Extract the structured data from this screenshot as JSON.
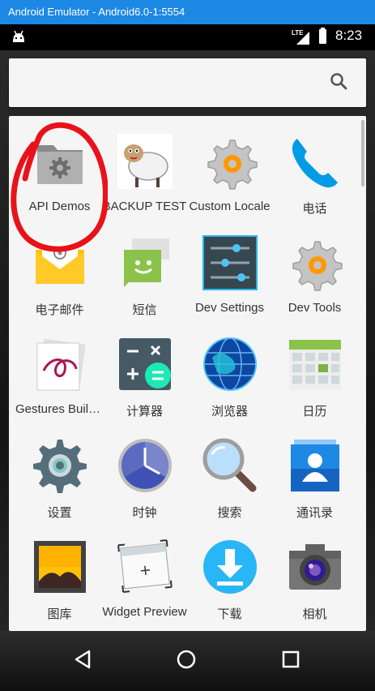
{
  "window": {
    "title": "Android Emulator - Android6.0-1:5554"
  },
  "status_bar": {
    "network": "LTE",
    "time": "8:23"
  },
  "search": {
    "placeholder": ""
  },
  "apps": [
    {
      "label": "API Demos",
      "icon": "settings-folder-icon"
    },
    {
      "label": "BACKUP TEST",
      "icon": "sheep-icon"
    },
    {
      "label": "Custom Locale",
      "icon": "gear-locale-icon"
    },
    {
      "label": "电话",
      "icon": "phone-icon"
    },
    {
      "label": "电子邮件",
      "icon": "email-icon"
    },
    {
      "label": "短信",
      "icon": "sms-icon"
    },
    {
      "label": "Dev Settings",
      "icon": "sliders-icon"
    },
    {
      "label": "Dev Tools",
      "icon": "gear-tools-icon"
    },
    {
      "label": "Gestures Builder",
      "icon": "gestures-icon"
    },
    {
      "label": "计算器",
      "icon": "calculator-icon"
    },
    {
      "label": "浏览器",
      "icon": "globe-icon"
    },
    {
      "label": "日历",
      "icon": "calendar-icon"
    },
    {
      "label": "设置",
      "icon": "settings-icon"
    },
    {
      "label": "时钟",
      "icon": "clock-icon"
    },
    {
      "label": "搜索",
      "icon": "magnifier-icon"
    },
    {
      "label": "通讯录",
      "icon": "contacts-icon"
    },
    {
      "label": "图库",
      "icon": "gallery-icon"
    },
    {
      "label": "Widget Preview",
      "icon": "widget-preview-icon"
    },
    {
      "label": "下载",
      "icon": "download-icon"
    },
    {
      "label": "相机",
      "icon": "camera-icon"
    }
  ],
  "colors": {
    "title_bar": "#1e88e5",
    "annotation": "#e8131a"
  }
}
